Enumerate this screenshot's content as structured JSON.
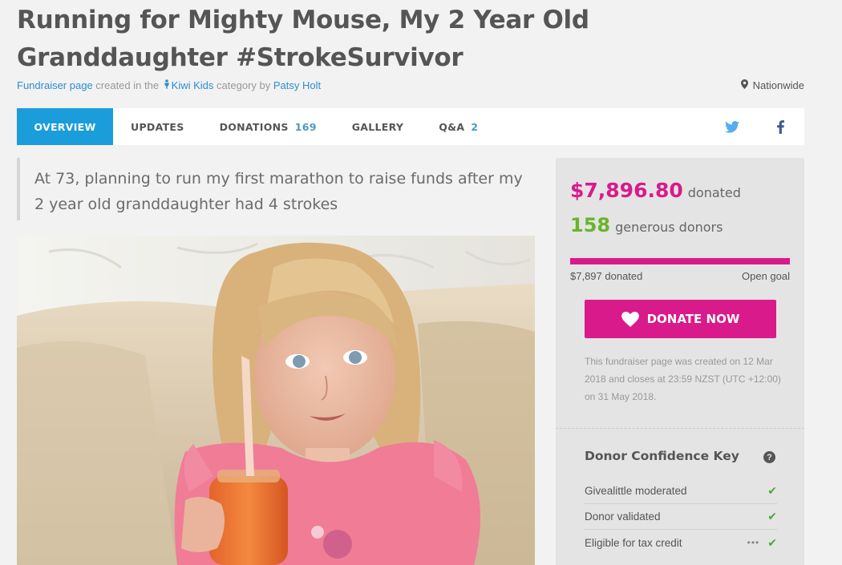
{
  "page": {
    "title": "Running for Mighty Mouse, My 2 Year Old Granddaughter #StrokeSurvivor"
  },
  "meta": {
    "link_fundraiser": "Fundraiser page",
    "text_created": " created in the ",
    "category": "Kiwi Kids",
    "text_category_by": " category by ",
    "author": "Patsy Holt",
    "location": "Nationwide"
  },
  "tabs": [
    {
      "label": "OVERVIEW",
      "count": null
    },
    {
      "label": "UPDATES",
      "count": null
    },
    {
      "label": "DONATIONS",
      "count": "169"
    },
    {
      "label": "GALLERY",
      "count": null
    },
    {
      "label": "Q&A",
      "count": "2"
    }
  ],
  "quote": "At 73, planning to run my first marathon to raise funds after my 2 year old granddaughter had 4 strokes",
  "summary": {
    "amount": "$7,896.80",
    "amount_label": "donated",
    "donors": "158",
    "donors_label": "generous donors",
    "progress_fraction": 1.0,
    "progress_left": "$7,897 donated",
    "progress_right": "Open goal",
    "donate_label": "DONATE NOW",
    "fine_print": "This fundraiser page was created on 12 Mar 2018 and closes at 23:59 NZST (UTC +12:00) on 31 May 2018."
  },
  "confidence": {
    "title": "Donor Confidence Key",
    "items": [
      {
        "label": "Givealittle moderated",
        "dots": false
      },
      {
        "label": "Donor validated",
        "dots": false
      },
      {
        "label": "Eligible for tax credit",
        "dots": true
      }
    ]
  },
  "colors": {
    "accent_blue": "#1b9ddb",
    "brand_pink": "#d91a8b",
    "donor_green": "#6ab42d",
    "check_green": "#4fa63b",
    "twitter": "#55acee",
    "facebook": "#3b5998"
  },
  "icons": [
    "person-icon",
    "location-pin-icon",
    "twitter-icon",
    "facebook-icon",
    "heart-icon",
    "help-icon",
    "check-icon",
    "more-dots-icon"
  ]
}
